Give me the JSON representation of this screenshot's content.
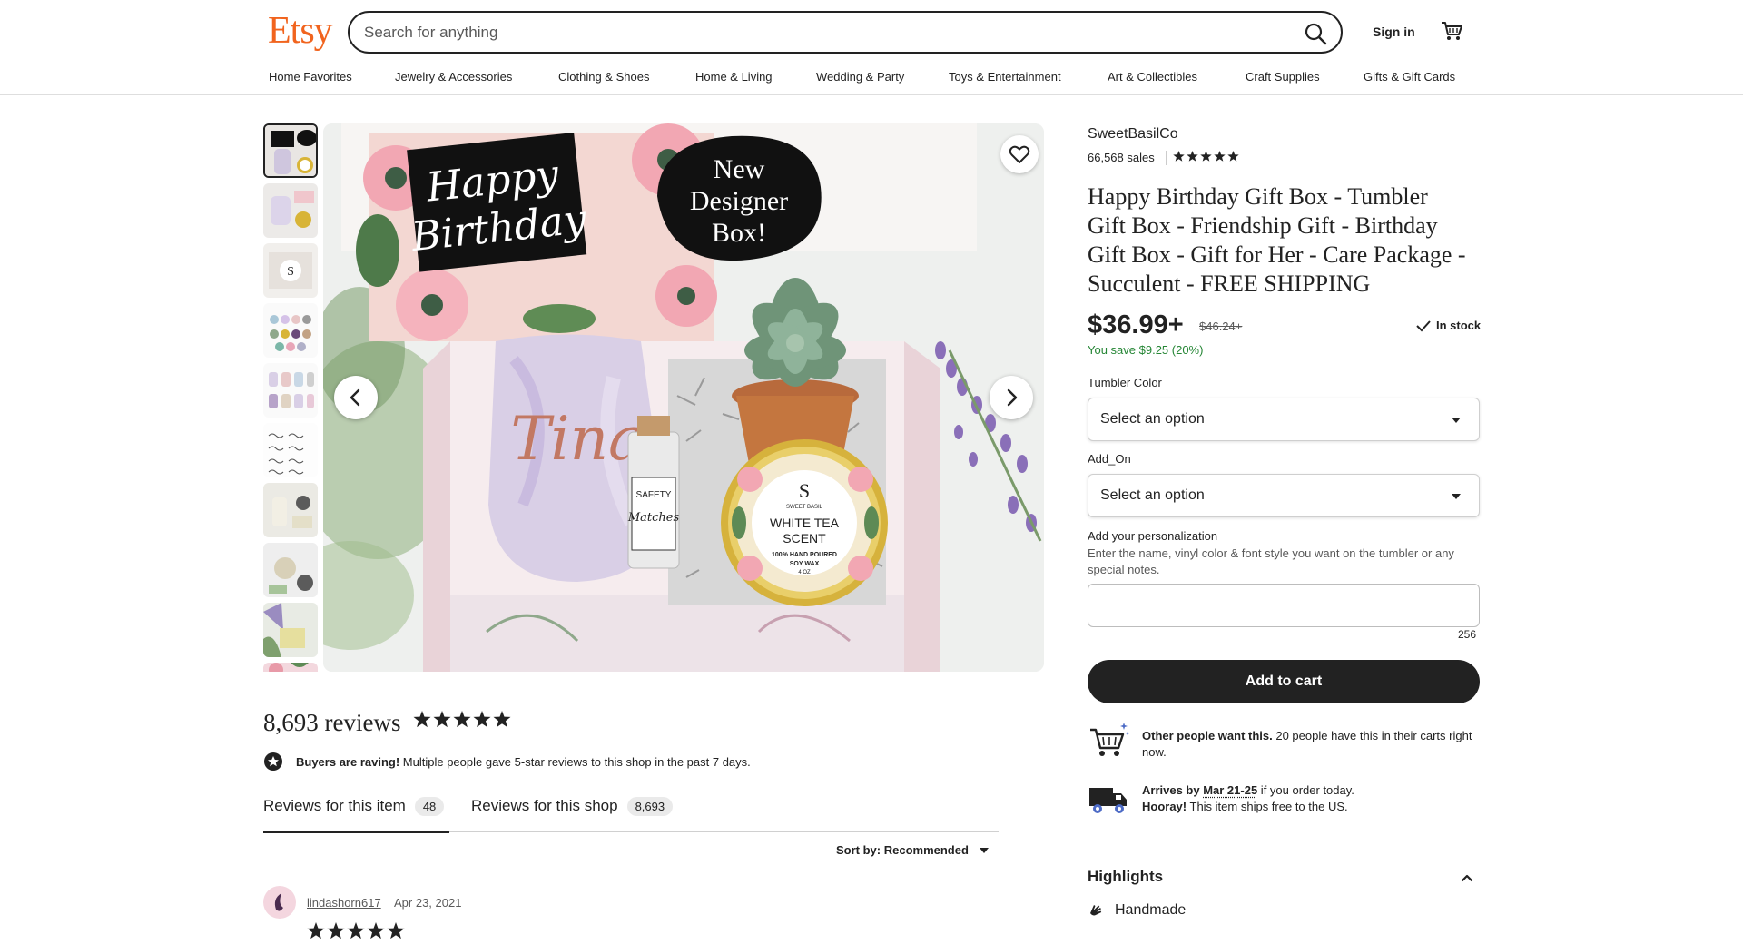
{
  "header": {
    "logo": "Etsy",
    "search_placeholder": "Search for anything",
    "signin": "Sign in",
    "nav": [
      "Home Favorites",
      "Jewelry & Accessories",
      "Clothing & Shoes",
      "Home & Living",
      "Wedding & Party",
      "Toys & Entertainment",
      "Art & Collectibles",
      "Craft Supplies",
      "Gifts & Gift Cards"
    ]
  },
  "gallery": {
    "thumbnail_count": 10,
    "active_thumbnail": 1,
    "main_image": {
      "card_text_1": "Happy",
      "card_text_2": "Birthday",
      "badge_lines": [
        "New",
        "Designer",
        "Box!"
      ],
      "tumbler_name": "Tina",
      "candle_brand": "S",
      "candle_sub": "SWEET BASIL",
      "candle_scent_1": "WHITE TEA",
      "candle_scent_2": "SCENT",
      "candle_desc_1": "100% HAND POURED",
      "candle_desc_2": "SOY WAX",
      "candle_size": "4 OZ",
      "matches_1": "SAFETY",
      "matches_2": "Matches"
    }
  },
  "reviews": {
    "count_label": "8,693 reviews",
    "rating": 5,
    "raving_bold": "Buyers are raving!",
    "raving_text": " Multiple people gave 5-star reviews to this shop in the past 7 days.",
    "tabs": [
      {
        "label": "Reviews for this item",
        "count": "48"
      },
      {
        "label": "Reviews for this shop",
        "count": "8,693"
      }
    ],
    "sort_label": "Sort by: Recommended",
    "first_review": {
      "user": "lindashorn617",
      "date": "Apr 23, 2021",
      "rating": 5
    }
  },
  "listing": {
    "shop_name": "SweetBasilCo",
    "sales": "66,568 sales",
    "shop_rating": 5,
    "title": "Happy Birthday Gift Box - Tumbler Gift Box - Friendship Gift - Birthday Gift Box - Gift for Her - Care Package - Succulent - FREE SHIPPING",
    "price": "$36.99+",
    "original_price": "$46.24+",
    "stock": "In stock",
    "savings": "You save $9.25 (20%)",
    "options": [
      {
        "label": "Tumbler Color",
        "value": "Select an option"
      },
      {
        "label": "Add_On",
        "value": "Select an option"
      }
    ],
    "personalization_label": "Add your personalization",
    "personalization_help": "Enter the name, vinyl color & font style you want on the tumbler or any special notes.",
    "personalization_value": "",
    "char_limit": "256",
    "add_to_cart": "Add to cart",
    "demand_bold": "Other people want this.",
    "demand_text": " 20 people have this in their carts right now.",
    "arrives_pre": "Arrives by ",
    "arrives_date": "Mar 21-25",
    "arrives_post": " if you order today.",
    "hooray_bold": "Hooray!",
    "hooray_text": " This item ships free to the US.",
    "highlights": "Highlights",
    "handmade": "Handmade"
  },
  "colors": {
    "brand": "#f1641e",
    "savings_green": "#258635",
    "button_dark": "#222222"
  }
}
